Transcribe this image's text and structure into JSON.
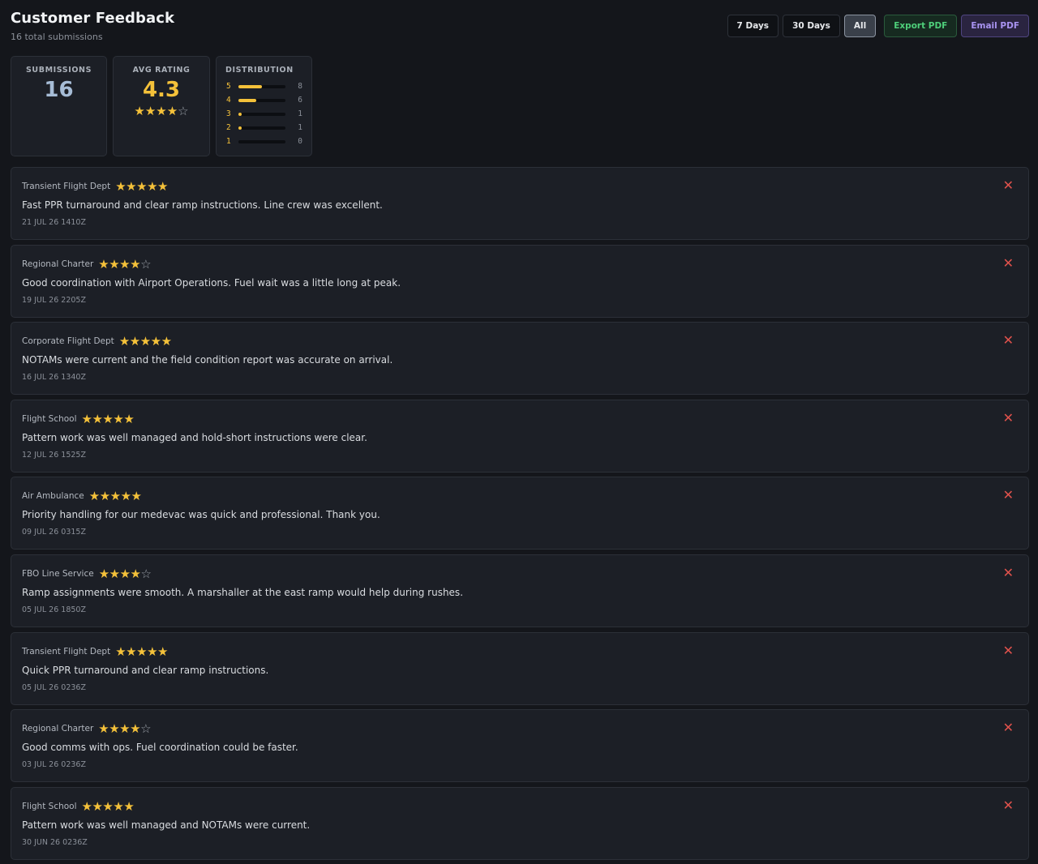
{
  "header": {
    "title": "Customer Feedback",
    "subtitle": "16 total submissions"
  },
  "toolbar": {
    "filters": [
      {
        "label": "7 Days",
        "active": false
      },
      {
        "label": "30 Days",
        "active": false
      },
      {
        "label": "All",
        "active": true
      }
    ],
    "export_label": "Export PDF",
    "email_label": "Email PDF"
  },
  "stats": {
    "submissions_label": "SUBMISSIONS",
    "submissions_value": "16",
    "avg_label": "AVG RATING",
    "avg_value": "4.3",
    "avg_stars": 4,
    "distribution_label": "DISTRIBUTION",
    "distribution": [
      {
        "level": "5",
        "count": "8",
        "fraction": 0.5
      },
      {
        "level": "4",
        "count": "6",
        "fraction": 0.375
      },
      {
        "level": "3",
        "count": "1",
        "fraction": 0.0625
      },
      {
        "level": "2",
        "count": "1",
        "fraction": 0.0625
      },
      {
        "level": "1",
        "count": "0",
        "fraction": 0
      }
    ]
  },
  "colors": {
    "accent_gold": "#f4c13a",
    "danger": "#e0524c",
    "export_green": "#4ecf7a",
    "email_purple": "#a893f0"
  },
  "icons": {
    "star_filled": "★",
    "star_empty": "☆",
    "close": "✕"
  },
  "feedback": [
    {
      "source": "Transient Flight Dept",
      "rating": 5,
      "text": "Fast PPR turnaround and clear ramp instructions. Line crew was excellent.",
      "date": "21 JUL 26 1410Z"
    },
    {
      "source": "Regional Charter",
      "rating": 4,
      "text": "Good coordination with Airport Operations. Fuel wait was a little long at peak.",
      "date": "19 JUL 26 2205Z"
    },
    {
      "source": "Corporate Flight Dept",
      "rating": 5,
      "text": "NOTAMs were current and the field condition report was accurate on arrival.",
      "date": "16 JUL 26 1340Z"
    },
    {
      "source": "Flight School",
      "rating": 5,
      "text": "Pattern work was well managed and hold-short instructions were clear.",
      "date": "12 JUL 26 1525Z"
    },
    {
      "source": "Air Ambulance",
      "rating": 5,
      "text": "Priority handling for our medevac was quick and professional. Thank you.",
      "date": "09 JUL 26 0315Z"
    },
    {
      "source": "FBO Line Service",
      "rating": 4,
      "text": "Ramp assignments were smooth. A marshaller at the east ramp would help during rushes.",
      "date": "05 JUL 26 1850Z"
    },
    {
      "source": "Transient Flight Dept",
      "rating": 5,
      "text": "Quick PPR turnaround and clear ramp instructions.",
      "date": "05 JUL 26 0236Z"
    },
    {
      "source": "Regional Charter",
      "rating": 4,
      "text": "Good comms with ops. Fuel coordination could be faster.",
      "date": "03 JUL 26 0236Z"
    },
    {
      "source": "Flight School",
      "rating": 5,
      "text": "Pattern work was well managed and NOTAMs were current.",
      "date": "30 JUN 26 0236Z"
    }
  ]
}
